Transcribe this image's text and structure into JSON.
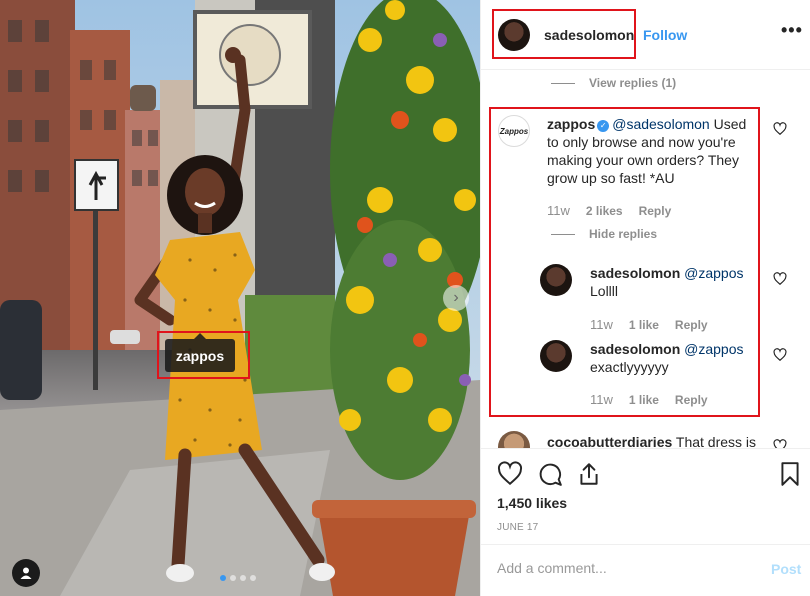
{
  "photo": {
    "tag_label": "zappos",
    "carousel": {
      "count": 4,
      "active": 1
    }
  },
  "header": {
    "username": "sadesolomon",
    "follow_label": "Follow",
    "more_label": "•••"
  },
  "comments": {
    "view_replies_label": "View replies (1)",
    "main_comment": {
      "avatar_text": "Zappos",
      "username": "zappos",
      "mention": "@sadesolomon",
      "text": "Used to only browse and now you're making your own orders? They grow up so fast! *AU",
      "time": "11w",
      "likes": "2 likes",
      "reply_label": "Reply",
      "hide_replies_label": "Hide replies"
    },
    "replies": [
      {
        "username": "sadesolomon",
        "mention": "@zappos",
        "text": "Lollll",
        "time": "11w",
        "likes": "1 like",
        "reply_label": "Reply"
      },
      {
        "username": "sadesolomon",
        "mention": "@zappos",
        "text": "exactlyyyyyy",
        "time": "11w",
        "likes": "1 like",
        "reply_label": "Reply"
      }
    ],
    "partial_comment": {
      "username": "cocoabutterdiaries",
      "text": "That dress is"
    }
  },
  "actions": {
    "likes": "1,450 likes",
    "date": "JUNE 17"
  },
  "add_comment": {
    "placeholder": "Add a comment...",
    "post_label": "Post"
  },
  "colors": {
    "accent": "#3897f0",
    "highlight_box": "#e0141b",
    "dress": "#e8a822"
  },
  "icons": [
    "more-icon",
    "heart-icon",
    "comment-icon",
    "share-icon",
    "bookmark-icon",
    "user-tag-icon",
    "chevron-right-icon",
    "verified-icon"
  ]
}
